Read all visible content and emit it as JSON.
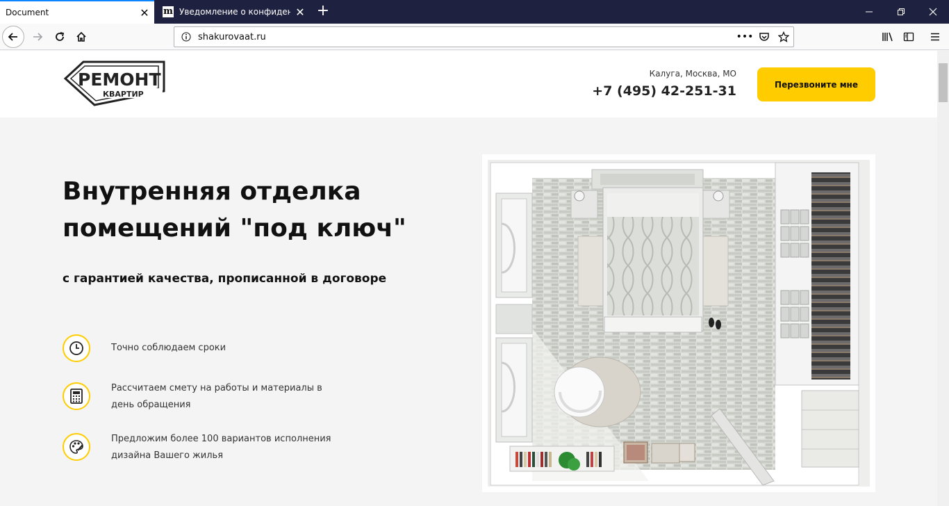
{
  "browser": {
    "tabs": [
      {
        "title": "Document",
        "active": true
      },
      {
        "title": "Уведомление о конфиденциальности",
        "active": false,
        "favicon": "m"
      }
    ],
    "url": "shakurovaat.ru"
  },
  "header": {
    "logo": {
      "line1": "РЕМОНТ",
      "line2": "КВАРТИР"
    },
    "cities": "Калуга, Москва, МО",
    "phone": "+7 (495) 42-251-31",
    "callback_label": "Перезвоните мне"
  },
  "hero": {
    "title": "Внутренняя отделка помещений \"под ключ\"",
    "subtitle": "с гарантией качества, прописанной в договоре"
  },
  "features": [
    {
      "icon": "clock-icon",
      "text": "Точно соблюдаем сроки"
    },
    {
      "icon": "calculator-icon",
      "text": "Рассчитаем смету на работы и материалы в день обращения"
    },
    {
      "icon": "palette-icon",
      "text": "Предложим более 100 вариантов исполнения дизайна Вашего жилья"
    }
  ],
  "colors": {
    "accent": "#ffcc00",
    "tabbar": "#1f2140"
  }
}
